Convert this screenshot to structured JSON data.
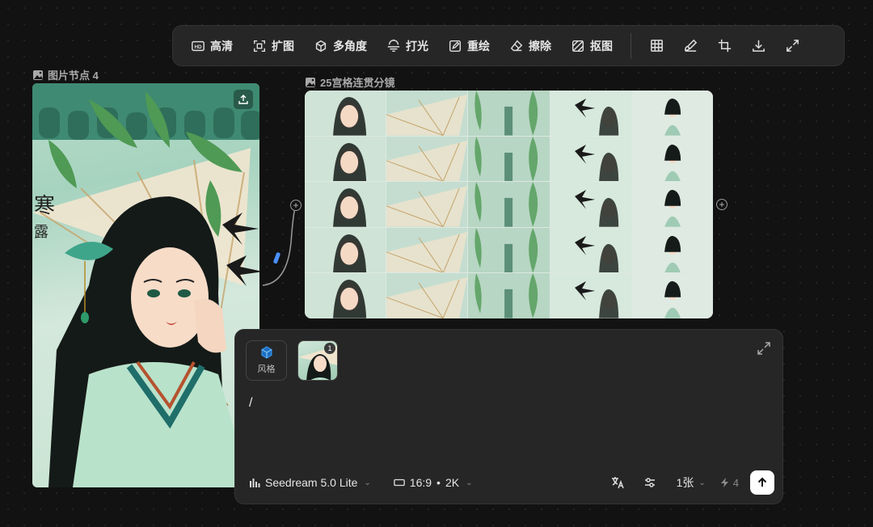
{
  "toolbar": {
    "buttons": [
      {
        "label": "高清",
        "icon": "hd-icon"
      },
      {
        "label": "扩图",
        "icon": "expand-image-icon"
      },
      {
        "label": "多角度",
        "icon": "multi-angle-icon"
      },
      {
        "label": "打光",
        "icon": "lighting-icon"
      },
      {
        "label": "重绘",
        "icon": "redraw-icon"
      },
      {
        "label": "擦除",
        "icon": "eraser-icon"
      },
      {
        "label": "抠图",
        "icon": "cutout-icon"
      }
    ],
    "icons": [
      "grid-icon",
      "brush-icon",
      "crop-icon",
      "download-icon",
      "fullscreen-icon"
    ]
  },
  "image_node": {
    "label": "图片节点 4"
  },
  "grid_node": {
    "label": "25宫格连贯分镜"
  },
  "prompt": {
    "style_label": "风格",
    "ref_count": "1",
    "text": "/",
    "model": "Seedream 5.0 Lite",
    "ratio": "16:9",
    "resolution": "2K",
    "count": "1张",
    "credits": "4"
  },
  "colors": {
    "background": "#121212",
    "panel": "#262626",
    "accent_cube": "#3aa0ff",
    "connector": "#4a90ff"
  }
}
